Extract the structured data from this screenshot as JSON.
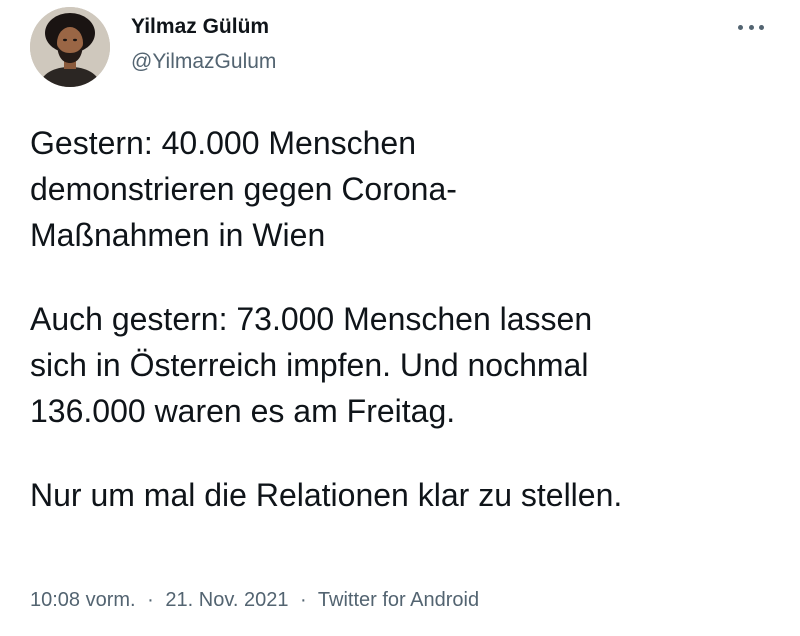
{
  "author": {
    "name": "Yilmaz Gülüm",
    "handle": "@YilmazGulum"
  },
  "tweet": {
    "paragraphs": [
      "Gestern: 40.000 Menschen\ndemonstrieren gegen Corona-\nMaßnahmen in Wien",
      "Auch gestern: 73.000 Menschen lassen\nsich in Österreich impfen. Und nochmal\n136.000 waren es am Freitag.",
      "Nur um mal die Relationen klar zu stellen."
    ],
    "time": "10:08 vorm.",
    "date": "21. Nov. 2021",
    "separator": "·",
    "source": "Twitter for Android"
  },
  "icons": {
    "more": "more-horizontal-icon",
    "avatar": "profile-photo"
  },
  "colors": {
    "primary_text": "#0f1419",
    "secondary_text": "#536471",
    "background": "#ffffff"
  }
}
